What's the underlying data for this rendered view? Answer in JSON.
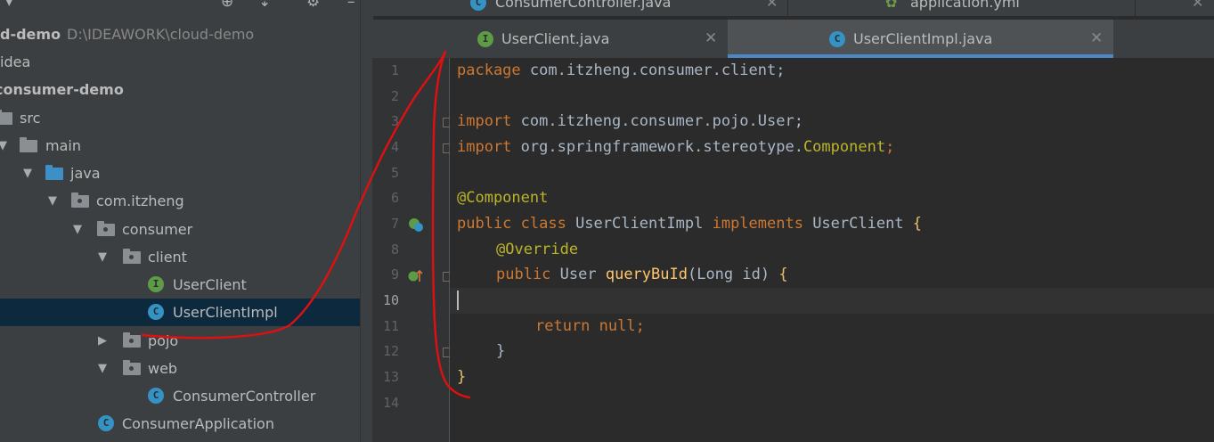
{
  "project_tree": {
    "items": [
      {
        "label": "d-demo",
        "path": "D:\\IDEAWORK\\cloud-demo"
      },
      {
        "label": "idea"
      },
      {
        "label": "consumer-demo"
      },
      {
        "label": "src"
      },
      {
        "label": "main"
      },
      {
        "label": "java"
      },
      {
        "label": "com.itzheng"
      },
      {
        "label": "consumer"
      },
      {
        "label": "client"
      },
      {
        "label": "UserClient"
      },
      {
        "label": "UserClientImpl"
      },
      {
        "label": "pojo"
      },
      {
        "label": "web"
      },
      {
        "label": "ConsumerController"
      },
      {
        "label": "ConsumerApplication"
      }
    ]
  },
  "top_tabs": [
    {
      "label": "ConsumerController.java"
    },
    {
      "label": "application.yml"
    }
  ],
  "editor_tabs": [
    {
      "label": "UserClient.java",
      "icon": "interface-icon",
      "active": false
    },
    {
      "label": "UserClientImpl.java",
      "icon": "class-icon",
      "active": true
    }
  ],
  "icon_letters": {
    "class": "C",
    "interface": "I"
  },
  "line_numbers": [
    "1",
    "2",
    "3",
    "4",
    "5",
    "6",
    "7",
    "8",
    "9",
    "10",
    "11",
    "12",
    "13",
    "14"
  ],
  "current_line": "10",
  "code": {
    "l1": {
      "kw": "package",
      "rest": " com.itzheng.consumer.client;"
    },
    "l3": {
      "kw": "import",
      "rest": " com.itzheng.consumer.pojo.User;"
    },
    "l4": {
      "kw": "import",
      "rest": " org.springframework.stereotype.",
      "cls": "Component",
      "end": ";"
    },
    "l6": {
      "ann": "@Component"
    },
    "l7": {
      "kw1": "public class",
      "name": " UserClientImpl ",
      "kw2": "implements",
      "iface": " UserClient ",
      "brace": "{"
    },
    "l8": {
      "ann": "@Override"
    },
    "l9": {
      "kw": "public",
      "type": " User ",
      "method": "queryBuId",
      "params": "(Long id) ",
      "brace": "{"
    },
    "l11": {
      "kw": "return null;"
    },
    "l12": {
      "brace": "}"
    },
    "l13": {
      "brace": "}"
    }
  },
  "colors": {
    "keyword": "#cc7832",
    "annotation": "#bbb529",
    "method": "#ffc66d",
    "text": "#a9b7c6",
    "selection": "#0d293e",
    "annotation_stroke": "#e01010"
  }
}
